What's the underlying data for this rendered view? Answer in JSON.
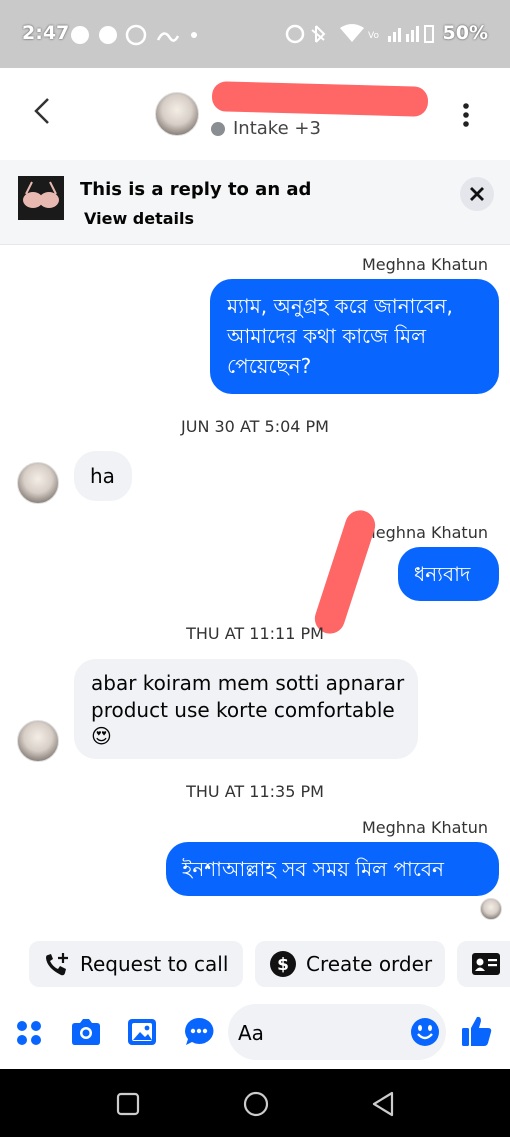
{
  "status_bar": {
    "time": "2:47",
    "battery": "50%"
  },
  "header": {
    "subtitle": "Intake +3"
  },
  "ad_banner": {
    "title": "This is a reply to an ad",
    "link": "View details"
  },
  "messages": {
    "m1_sender": "Meghna Khatun",
    "m1_line1": "ম্যাম, অনুগ্রহ করে জানাবেন,",
    "m1_line2": "আমাদের কথা কাজে মিল",
    "m1_line3": "পেয়েছেন?",
    "ts1": "JUN 30 AT 5:04 PM",
    "m2_text": "ha",
    "m3_sender": "Meghna Khatun",
    "m3_text": "ধন্যবাদ",
    "ts2": "THU AT 11:11 PM",
    "m4_line1": "abar koiram mem sotti apnarar",
    "m4_line2": "product use korte comfortable",
    "m4_emoji": "😍",
    "ts3": "THU AT 11:35 PM",
    "m5_sender": "Meghna Khatun",
    "m5_text": "ইনশাআল্লাহ সব সময় মিল পাবেন"
  },
  "quick_actions": {
    "request_call": "Request to call",
    "create_order": "Create order"
  },
  "composer": {
    "placeholder": "Aa"
  },
  "colors": {
    "accent": "#0866ff",
    "incoming_bubble": "#f0f2f5",
    "redaction": "#ff6666"
  }
}
